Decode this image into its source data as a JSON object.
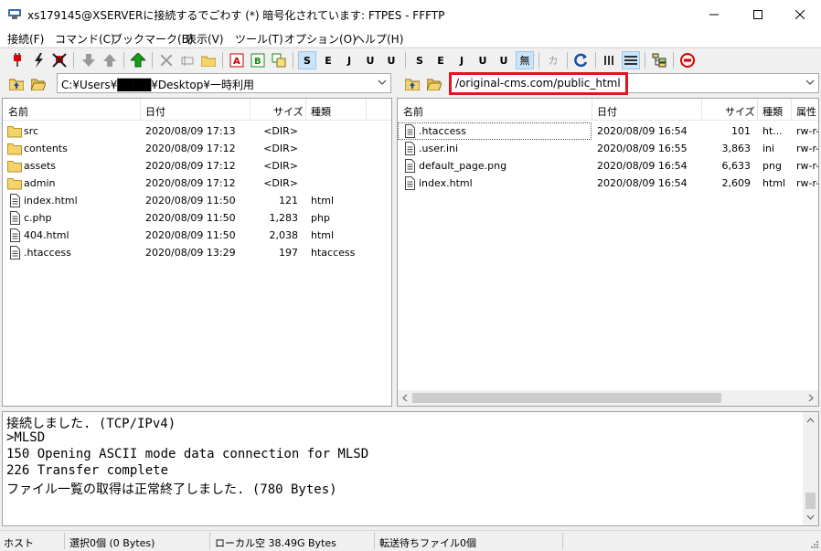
{
  "window": {
    "title": "xs179145@XSERVERに接続するでごわす (*) 暗号化されています: FTPES - FFFTP"
  },
  "menu": [
    "接続(F)",
    "コマンド(C)",
    "ブックマーク(B)",
    "表示(V)",
    "ツール(T)",
    "オプション(O)",
    "ヘルプ(H)"
  ],
  "toolbar": {
    "ascii_btns": [
      "S",
      "E",
      "J",
      "U",
      "U"
    ],
    "ascii_btns_2": [
      "S",
      "E",
      "J",
      "U",
      "U"
    ],
    "mu_label": "無",
    "ka_label": "カ",
    "transfer_a": "A",
    "transfer_b": "B"
  },
  "local": {
    "path": "C:¥Users¥████¥Desktop¥一時利用",
    "columns": [
      "名前",
      "日付",
      "サイズ",
      "種類"
    ],
    "rows": [
      {
        "name": "src",
        "date": "2020/08/09 17:13",
        "size": "<DIR>",
        "type": "",
        "kind": "folder"
      },
      {
        "name": "contents",
        "date": "2020/08/09 17:12",
        "size": "<DIR>",
        "type": "",
        "kind": "folder"
      },
      {
        "name": "assets",
        "date": "2020/08/09 17:12",
        "size": "<DIR>",
        "type": "",
        "kind": "folder"
      },
      {
        "name": "admin",
        "date": "2020/08/09 17:12",
        "size": "<DIR>",
        "type": "",
        "kind": "folder"
      },
      {
        "name": "index.html",
        "date": "2020/08/09 11:50",
        "size": "121",
        "type": "html",
        "kind": "file"
      },
      {
        "name": "c.php",
        "date": "2020/08/09 11:50",
        "size": "1,283",
        "type": "php",
        "kind": "file"
      },
      {
        "name": "404.html",
        "date": "2020/08/09 11:50",
        "size": "2,038",
        "type": "html",
        "kind": "file"
      },
      {
        "name": ".htaccess",
        "date": "2020/08/09 13:29",
        "size": "197",
        "type": "htaccess",
        "kind": "file"
      }
    ]
  },
  "remote": {
    "path": "/original-cms.com/public_html",
    "columns": [
      "名前",
      "日付",
      "サイズ",
      "種類",
      "属性"
    ],
    "rows": [
      {
        "name": ".htaccess",
        "date": "2020/08/09 16:54",
        "size": "101",
        "type": "ht...",
        "attr": "rw-r-"
      },
      {
        "name": ".user.ini",
        "date": "2020/08/09 16:55",
        "size": "3,863",
        "type": "ini",
        "attr": "rw-r-"
      },
      {
        "name": "default_page.png",
        "date": "2020/08/09 16:54",
        "size": "6,633",
        "type": "png",
        "attr": "rw-r-"
      },
      {
        "name": "index.html",
        "date": "2020/08/09 16:54",
        "size": "2,609",
        "type": "html",
        "attr": "rw-r-"
      }
    ]
  },
  "log": [
    "接続しました. (TCP/IPv4)",
    ">MLSD",
    "150 Opening ASCII mode data connection for MLSD",
    "226 Transfer complete",
    "ファイル一覧の取得は正常終了しました. (780 Bytes)"
  ],
  "status": {
    "host": "ホスト",
    "selected": "選択0個 (0 Bytes)",
    "local_free": "ローカル空 38.49G Bytes",
    "queue": "転送待ちファイル0個"
  },
  "colors": {
    "highlight": "#e0141e",
    "selection": "#cce4f7"
  }
}
